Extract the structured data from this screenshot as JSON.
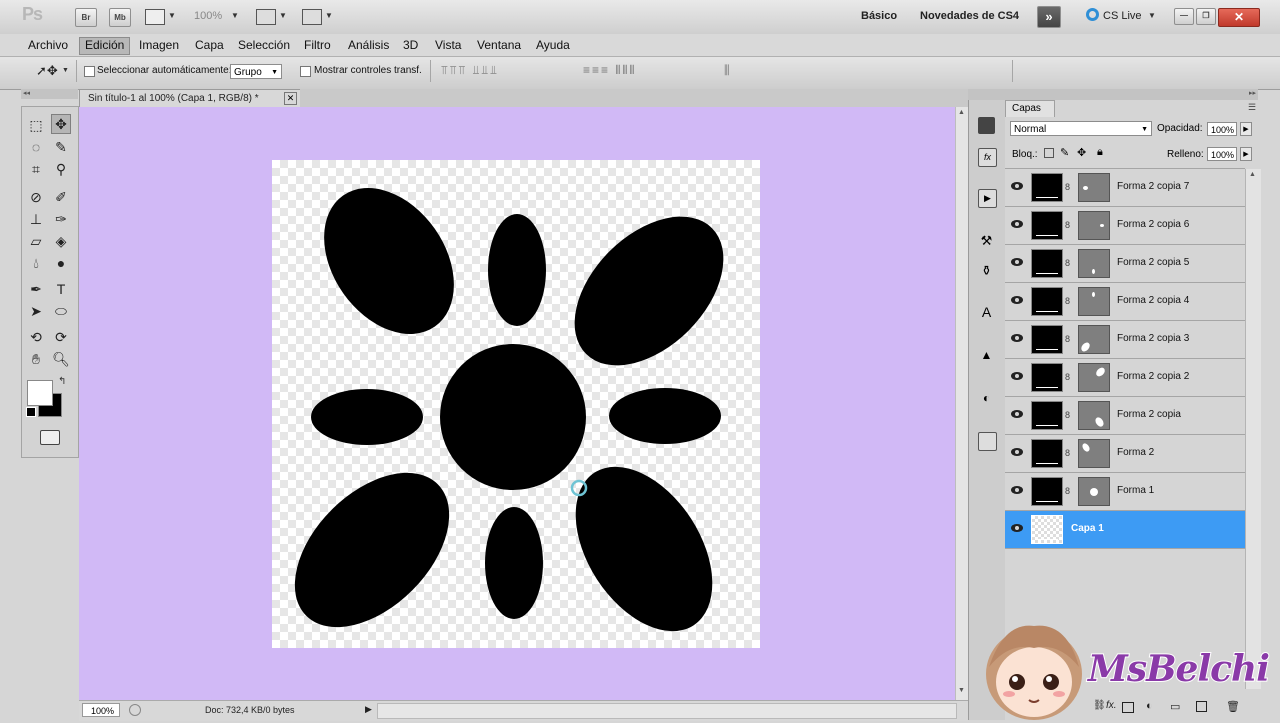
{
  "appbar": {
    "ps_logo": "Ps",
    "br": "Br",
    "mb": "Mb",
    "zoom": "100%",
    "workspace_basic": "Básico",
    "workspace_new": "Novedades de CS4",
    "cs_live": "CS Live"
  },
  "menu": [
    "Archivo",
    "Edición",
    "Imagen",
    "Capa",
    "Selección",
    "Filtro",
    "Análisis",
    "3D",
    "Vista",
    "Ventana",
    "Ayuda"
  ],
  "options": {
    "auto_select_label": "Seleccionar automáticamente:",
    "auto_select_value": "Grupo",
    "show_transform_label": "Mostrar controles transf."
  },
  "document": {
    "tab_title": "Sin título-1 al 100% (Capa 1, RGB/8) *",
    "zoom": "100%",
    "doc_info": "Doc: 732,4 KB/0 bytes"
  },
  "layers": {
    "panel_title": "Capas",
    "blend_mode": "Normal",
    "opacity_label": "Opacidad:",
    "opacity_value": "100%",
    "lock_label": "Bloq.:",
    "fill_label": "Relleno:",
    "fill_value": "100%",
    "items": [
      {
        "name": "Forma 2 copia 7"
      },
      {
        "name": "Forma 2 copia 6"
      },
      {
        "name": "Forma 2 copia 5"
      },
      {
        "name": "Forma 2 copia 4"
      },
      {
        "name": "Forma 2 copia 3"
      },
      {
        "name": "Forma 2 copia 2"
      },
      {
        "name": "Forma 2 copia"
      },
      {
        "name": "Forma 2"
      },
      {
        "name": "Forma 1"
      },
      {
        "name": "Capa 1"
      }
    ],
    "selected": "Capa 1"
  },
  "watermark": "MsBelchi",
  "colors": {
    "canvas_bg": "#d1b9f6",
    "selection": "#3d9bf4",
    "watermark": "#8a3aa8"
  }
}
